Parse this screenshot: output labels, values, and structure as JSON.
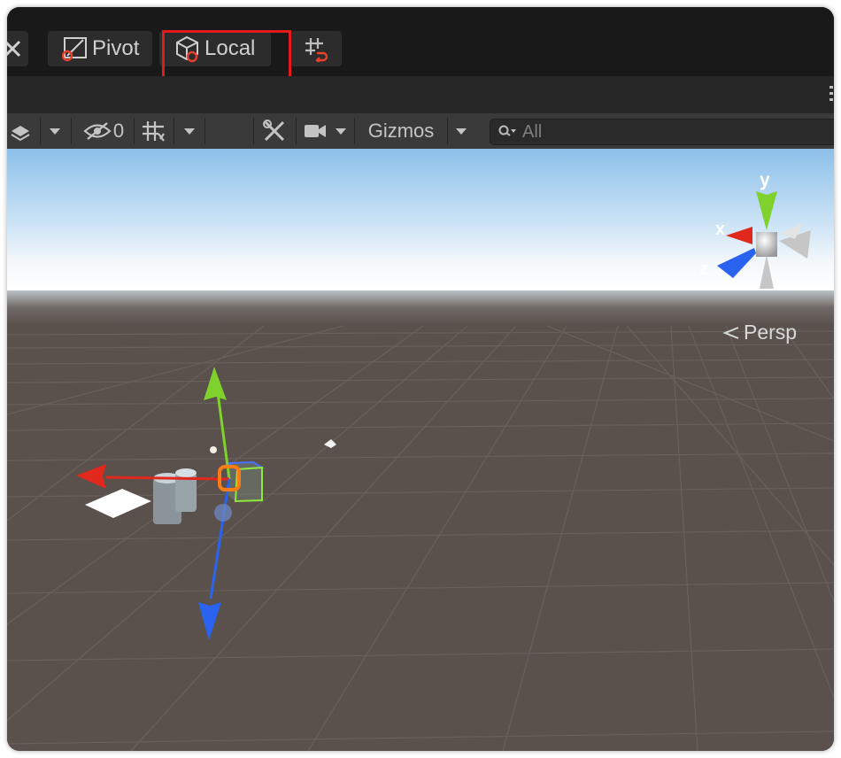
{
  "toolbar_top": {
    "pivot_label": "Pivot",
    "local_label": "Local"
  },
  "scene_toolbar": {
    "hidden_count": "0",
    "gizmos_label": "Gizmos",
    "search_placeholder": "All"
  },
  "orientation_gizmo": {
    "x_label": "x",
    "y_label": "y",
    "z_label": "z",
    "projection_label": "Persp"
  },
  "colors": {
    "x_axis": "#e0281c",
    "y_axis": "#7fd12b",
    "z_axis": "#2a63f0",
    "highlight": "#e3191c",
    "ground": "#5a514c"
  }
}
